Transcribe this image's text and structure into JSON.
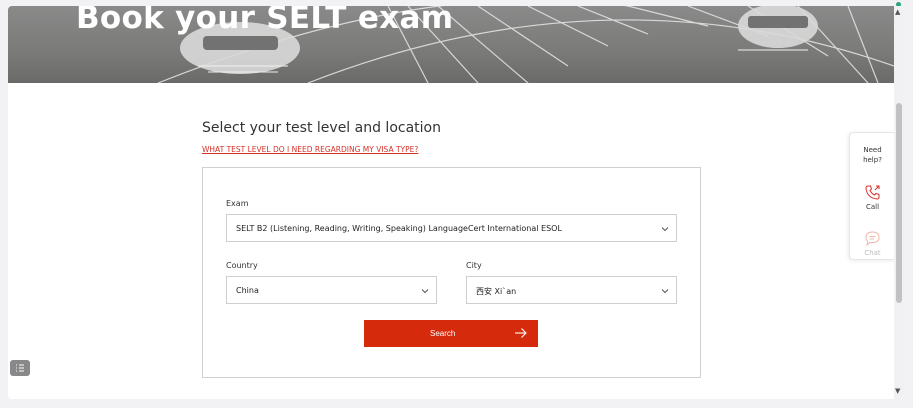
{
  "hero": {
    "title": "Book your SELT exam"
  },
  "form": {
    "heading": "Select your test level and location",
    "visa_link": "WHAT TEST LEVEL DO I NEED REGARDING MY VISA TYPE?",
    "exam": {
      "label": "Exam",
      "value": "SELT B2 (Listening, Reading, Writing, Speaking) LanguageCert International ESOL"
    },
    "country": {
      "label": "Country",
      "value": "China"
    },
    "city": {
      "label": "City",
      "value": "西安 Xi`an"
    },
    "search_label": "Search"
  },
  "help": {
    "line1": "Need",
    "line2": "help?",
    "call": "Call",
    "chat": "Chat"
  },
  "colors": {
    "accent": "#d62a0c",
    "link": "#d6322a"
  },
  "icons": [
    "phone-icon",
    "chat-icon",
    "arrow-right-icon",
    "chevron-down-icon",
    "list-icon"
  ]
}
